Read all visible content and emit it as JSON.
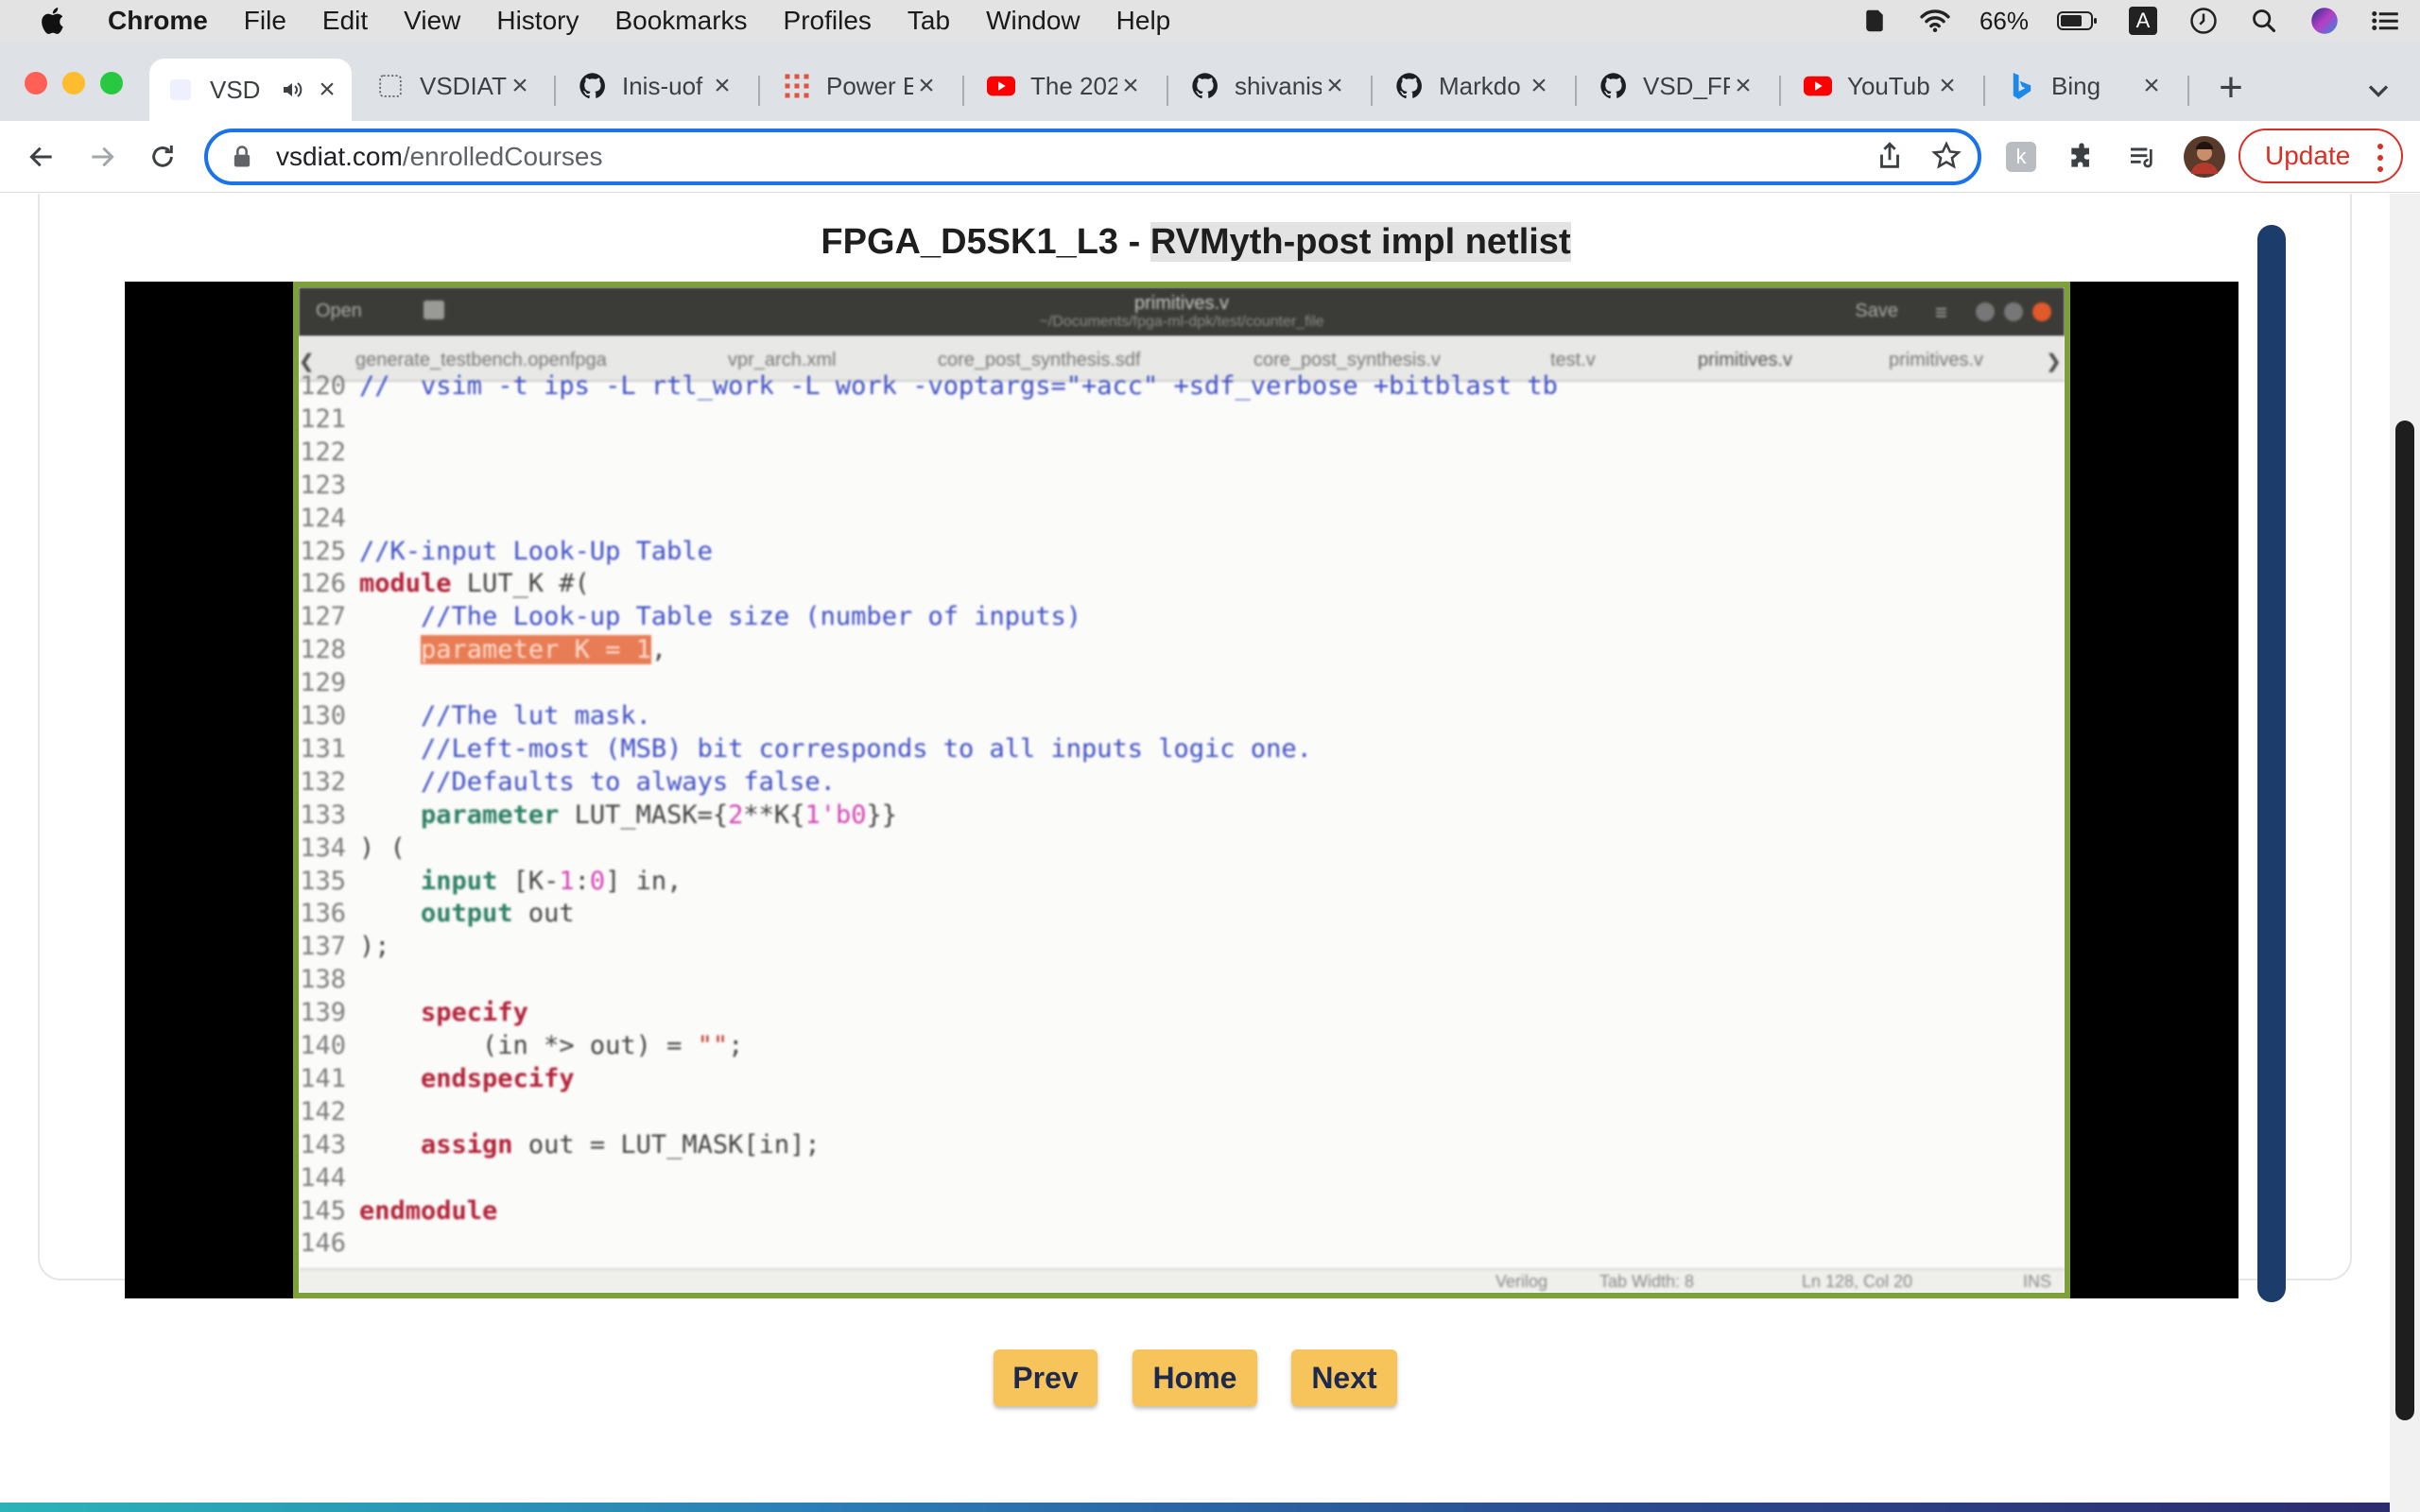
{
  "menubar": {
    "app": "Chrome",
    "items": [
      "File",
      "Edit",
      "View",
      "History",
      "Bookmarks",
      "Profiles",
      "Tab",
      "Window",
      "Help"
    ],
    "battery": "66%",
    "input_source": "A"
  },
  "tabs": [
    {
      "title": "VSD",
      "favicon": "vsdiat-icon",
      "active": true,
      "audio": true
    },
    {
      "title": "VSDIAT",
      "favicon": "vsdiat-icon"
    },
    {
      "title": "Inis-uof",
      "favicon": "github-icon"
    },
    {
      "title": "Power E",
      "favicon": "grid-icon"
    },
    {
      "title": "The 202",
      "favicon": "youtube-icon"
    },
    {
      "title": "shivanis",
      "favicon": "github-icon"
    },
    {
      "title": "Markdo",
      "favicon": "github-icon"
    },
    {
      "title": "VSD_FP",
      "favicon": "github-icon"
    },
    {
      "title": "YouTub",
      "favicon": "youtube-icon"
    },
    {
      "title": "Bing",
      "favicon": "bing-icon"
    }
  ],
  "toolbar": {
    "url_host": "vsdiat.com",
    "url_path": "/enrolledCourses",
    "update_label": "Update"
  },
  "lesson": {
    "title_prefix": "FPGA_D5SK1_L3 - ",
    "title_highlight": "RVMyth-post impl netlist"
  },
  "editor": {
    "open_label": "Open",
    "save_label": "Save",
    "doc_title": "primitives.v",
    "doc_subtitle": "~/Documents/fpga-ml-dpk/test/counter_file",
    "tabs": [
      "generate_testbench.openfpga",
      "vpr_arch.xml",
      "core_post_synthesis.sdf",
      "core_post_synthesis.v",
      "test.v",
      "primitives.v",
      "primitives.v"
    ],
    "status": [
      "Verilog",
      "Tab Width: 8",
      "Ln 128, Col 20",
      "INS"
    ]
  },
  "code_lines": [
    {
      "n": "120",
      "parts": [
        {
          "c": "cmt",
          "t": "//  vsim -t ips -L rtl_work -L work -voptargs=\"+acc\" +sdf_verbose +bitblast tb"
        }
      ]
    },
    {
      "n": "121",
      "parts": []
    },
    {
      "n": "122",
      "parts": []
    },
    {
      "n": "123",
      "parts": []
    },
    {
      "n": "124",
      "parts": []
    },
    {
      "n": "125",
      "parts": [
        {
          "c": "cmt",
          "t": "//K-input Look-Up Table"
        }
      ]
    },
    {
      "n": "126",
      "parts": [
        {
          "c": "kw",
          "t": "module"
        },
        {
          "c": "txt",
          "t": " LUT_K #("
        }
      ]
    },
    {
      "n": "127",
      "parts": [
        {
          "c": "txt",
          "t": "    "
        },
        {
          "c": "cmt",
          "t": "//The Look-up Table size (number of inputs)"
        }
      ]
    },
    {
      "n": "128",
      "parts": [
        {
          "c": "txt",
          "t": "    "
        },
        {
          "c": "sel",
          "t": "parameter K = 1"
        },
        {
          "c": "txt",
          "t": ","
        }
      ]
    },
    {
      "n": "129",
      "parts": []
    },
    {
      "n": "130",
      "parts": [
        {
          "c": "txt",
          "t": "    "
        },
        {
          "c": "cmt",
          "t": "//The lut mask."
        }
      ]
    },
    {
      "n": "131",
      "parts": [
        {
          "c": "txt",
          "t": "    "
        },
        {
          "c": "cmt",
          "t": "//Left-most (MSB) bit corresponds to all inputs logic one."
        }
      ]
    },
    {
      "n": "132",
      "parts": [
        {
          "c": "txt",
          "t": "    "
        },
        {
          "c": "cmt",
          "t": "//Defaults to always false."
        }
      ]
    },
    {
      "n": "133",
      "parts": [
        {
          "c": "txt",
          "t": "    "
        },
        {
          "c": "kw2",
          "t": "parameter"
        },
        {
          "c": "txt",
          "t": " LUT_MASK={"
        },
        {
          "c": "num",
          "t": "2"
        },
        {
          "c": "txt",
          "t": "**K{"
        },
        {
          "c": "num",
          "t": "1'b0"
        },
        {
          "c": "txt",
          "t": "}}"
        }
      ]
    },
    {
      "n": "134",
      "parts": [
        {
          "c": "txt",
          "t": ") ("
        }
      ]
    },
    {
      "n": "135",
      "parts": [
        {
          "c": "txt",
          "t": "    "
        },
        {
          "c": "kw2",
          "t": "input"
        },
        {
          "c": "txt",
          "t": " [K-"
        },
        {
          "c": "num",
          "t": "1"
        },
        {
          "c": "txt",
          "t": ":"
        },
        {
          "c": "num",
          "t": "0"
        },
        {
          "c": "txt",
          "t": "] in,"
        }
      ]
    },
    {
      "n": "136",
      "parts": [
        {
          "c": "txt",
          "t": "    "
        },
        {
          "c": "kw2",
          "t": "output"
        },
        {
          "c": "txt",
          "t": " out"
        }
      ]
    },
    {
      "n": "137",
      "parts": [
        {
          "c": "txt",
          "t": ");"
        }
      ]
    },
    {
      "n": "138",
      "parts": []
    },
    {
      "n": "139",
      "parts": [
        {
          "c": "txt",
          "t": "    "
        },
        {
          "c": "kw",
          "t": "specify"
        }
      ]
    },
    {
      "n": "140",
      "parts": [
        {
          "c": "txt",
          "t": "        (in *> out) = "
        },
        {
          "c": "str",
          "t": "\"\""
        },
        {
          "c": "txt",
          "t": ";"
        }
      ]
    },
    {
      "n": "141",
      "parts": [
        {
          "c": "txt",
          "t": "    "
        },
        {
          "c": "kw",
          "t": "endspecify"
        }
      ]
    },
    {
      "n": "142",
      "parts": []
    },
    {
      "n": "143",
      "parts": [
        {
          "c": "txt",
          "t": "    "
        },
        {
          "c": "kw",
          "t": "assign"
        },
        {
          "c": "txt",
          "t": " out = LUT_MASK[in];"
        }
      ]
    },
    {
      "n": "144",
      "parts": []
    },
    {
      "n": "145",
      "parts": [
        {
          "c": "kw",
          "t": "endmodule"
        }
      ]
    },
    {
      "n": "146",
      "parts": []
    }
  ],
  "nav": {
    "prev": "Prev",
    "home": "Home",
    "next": "Next"
  }
}
